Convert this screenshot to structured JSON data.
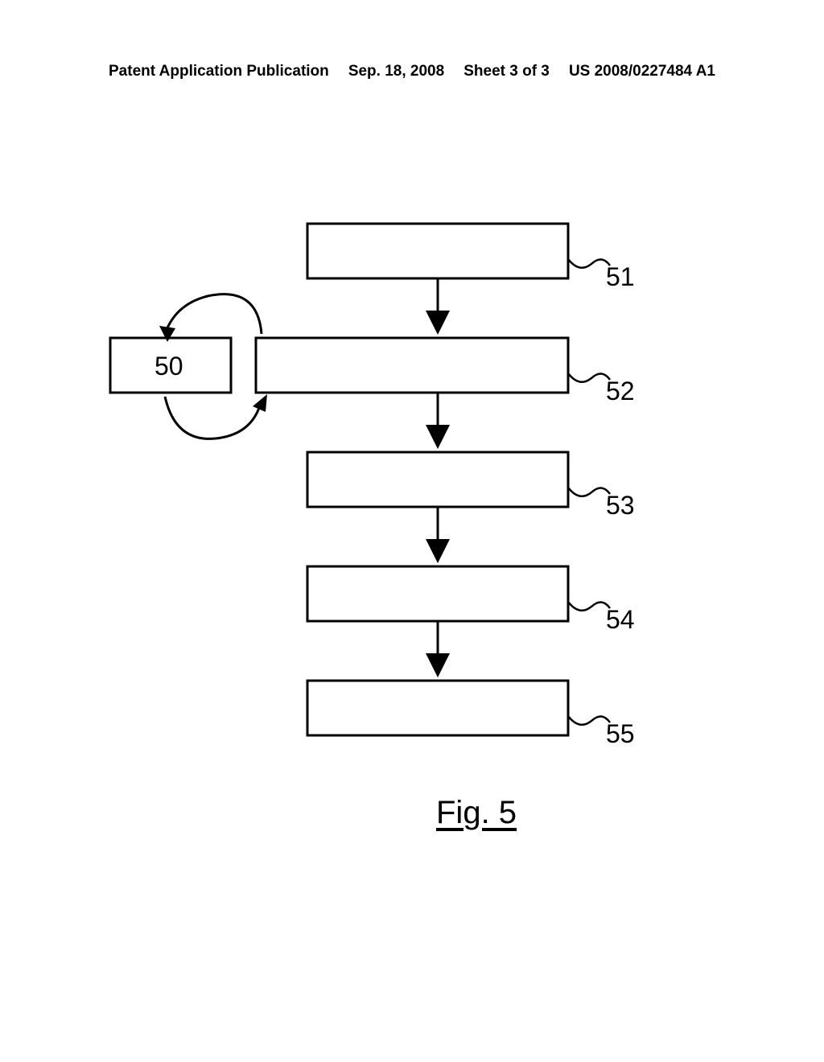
{
  "header": {
    "pubType": "Patent Application Publication",
    "date": "Sep. 18, 2008",
    "sheet": "Sheet 3 of 3",
    "docNumber": "US 2008/0227484 A1"
  },
  "figure": {
    "label": "Fig. 5",
    "boxes": {
      "b50": "50",
      "b51": "51",
      "b52": "52",
      "b53": "53",
      "b54": "54",
      "b55": "55"
    }
  }
}
